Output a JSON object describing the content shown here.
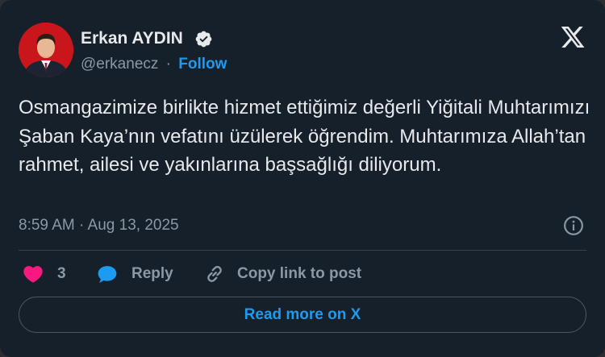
{
  "author": {
    "name": "Erkan AYDIN",
    "handle": "@erkanecz",
    "separator": "·",
    "follow_label": "Follow",
    "verified": true
  },
  "tweet": {
    "text": "Osmangazimize birlikte hizmet ettiğimiz değerli Yiğitali Muhtarımızı Şaban Kaya’nın vefatını üzülerek öğrendim. Muhtarımıza Allah’tan rahmet, ailesi ve yakınlarına başsağlığı diliyorum.",
    "timestamp": "8:59 AM · Aug 13, 2025"
  },
  "actions": {
    "like_count": "3",
    "reply_label": "Reply",
    "copy_label": "Copy link to post"
  },
  "read_more_label": "Read more on X",
  "colors": {
    "background": "#15202b",
    "accent": "#1d9bf0",
    "like": "#f91880",
    "text": "#e7e9ea",
    "muted": "#8b98a5",
    "border": "#38444d"
  },
  "icons": {
    "logo": "x-logo-icon",
    "verified": "verified-badge-icon",
    "info": "info-icon",
    "like": "heart-icon",
    "reply": "reply-bubble-icon",
    "copy": "link-icon"
  }
}
